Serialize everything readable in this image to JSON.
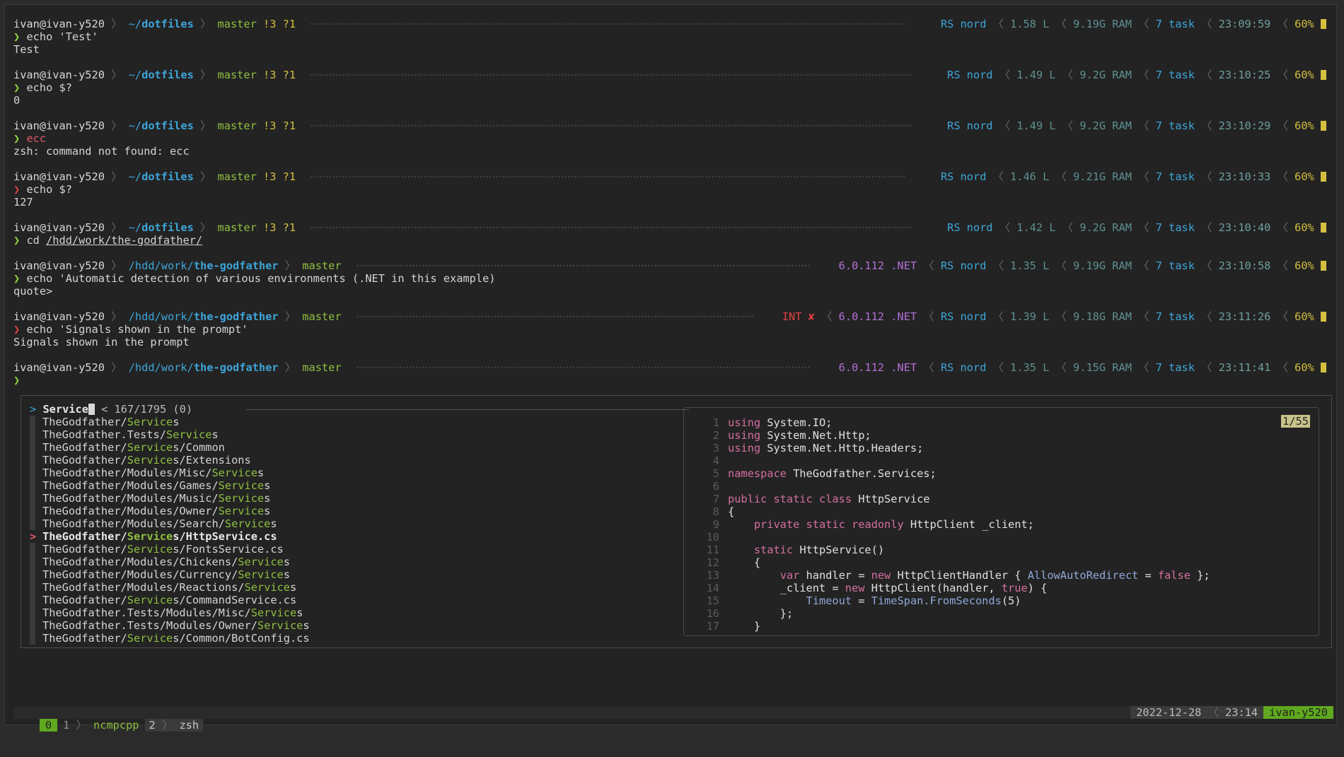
{
  "prompts": [
    {
      "host": "ivan@ivan-y520",
      "path_dim": "~/",
      "path_bold": "dotfiles",
      "git": "master",
      "gitflags": "!3 ?1",
      "int": "",
      "net": "",
      "rs": "RS nord",
      "load": "1.58 L",
      "ram": "9.19G RAM",
      "task": "7 task",
      "time": "23:09:59",
      "bat": "60%",
      "cmd": "echo 'Test'",
      "cmd_ok": true,
      "output": "Test"
    },
    {
      "host": "ivan@ivan-y520",
      "path_dim": "~/",
      "path_bold": "dotfiles",
      "git": "master",
      "gitflags": "!3 ?1",
      "int": "",
      "net": "",
      "rs": "RS nord",
      "load": "1.49 L",
      "ram": "9.2G RAM",
      "task": "7 task",
      "time": "23:10:25",
      "bat": "60%",
      "cmd": "echo $?",
      "cmd_ok": true,
      "output": "0"
    },
    {
      "host": "ivan@ivan-y520",
      "path_dim": "~/",
      "path_bold": "dotfiles",
      "git": "master",
      "gitflags": "!3 ?1",
      "int": "",
      "net": "",
      "rs": "RS nord",
      "load": "1.49 L",
      "ram": "9.2G RAM",
      "task": "7 task",
      "time": "23:10:29",
      "bat": "60%",
      "cmd": "ecc",
      "cmd_ok": true,
      "cmd_bad": true,
      "output": "zsh: command not found: ecc"
    },
    {
      "host": "ivan@ivan-y520",
      "path_dim": "~/",
      "path_bold": "dotfiles",
      "git": "master",
      "gitflags": "!3 ?1",
      "int": "",
      "net": "",
      "rs": "RS nord",
      "load": "1.46 L",
      "ram": "9.21G RAM",
      "task": "7 task",
      "time": "23:10:33",
      "bat": "60%",
      "cmd": "echo $?",
      "cmd_ok": false,
      "output": "127"
    },
    {
      "host": "ivan@ivan-y520",
      "path_dim": "~/",
      "path_bold": "dotfiles",
      "git": "master",
      "gitflags": "!3 ?1",
      "int": "",
      "net": "",
      "rs": "RS nord",
      "load": "1.42 L",
      "ram": "9.2G RAM",
      "task": "7 task",
      "time": "23:10:40",
      "bat": "60%",
      "cmd": "cd /hdd/work/the-godfather/",
      "cmd_ok": true,
      "underline_arg": "/hdd/work/the-godfather/",
      "output": ""
    },
    {
      "host": "ivan@ivan-y520",
      "path_dim": "/hdd/work/",
      "path_bold": "the-godfather",
      "git": "master",
      "gitflags": "",
      "int": "",
      "net": "6.0.112 .NET",
      "rs": "RS nord",
      "load": "1.35 L",
      "ram": "9.19G RAM",
      "task": "7 task",
      "time": "23:10:58",
      "bat": "60%",
      "cmd": "echo 'Automatic detection of various environments (.NET in this example)",
      "cmd_ok": true,
      "output": "quote>"
    },
    {
      "host": "ivan@ivan-y520",
      "path_dim": "/hdd/work/",
      "path_bold": "the-godfather",
      "git": "master",
      "gitflags": "",
      "int": "INT ✘",
      "net": "6.0.112 .NET",
      "rs": "RS nord",
      "load": "1.39 L",
      "ram": "9.18G RAM",
      "task": "7 task",
      "time": "23:11:26",
      "bat": "60%",
      "cmd": "echo 'Signals shown in the prompt'",
      "cmd_ok": false,
      "output": "Signals shown in the prompt"
    },
    {
      "host": "ivan@ivan-y520",
      "path_dim": "/hdd/work/",
      "path_bold": "the-godfather",
      "git": "master",
      "gitflags": "",
      "int": "",
      "net": "6.0.112 .NET",
      "rs": "RS nord",
      "load": "1.35 L",
      "ram": "9.15G RAM",
      "task": "7 task",
      "time": "23:11:41",
      "bat": "60%",
      "cmd": "",
      "cmd_ok": true,
      "output": ""
    }
  ],
  "symbols": {
    "arrow": "❯",
    "sep": "〉",
    "rsep": "〈",
    "fzf_prompt": ">",
    "fzf_sel": ">"
  },
  "fzf": {
    "query": "Service",
    "counter": "< 167/1795 (0)",
    "selected_index": 9,
    "items": [
      [
        "TheGodfather/",
        "Service",
        "s"
      ],
      [
        "TheGodfather.Tests/",
        "Service",
        "s"
      ],
      [
        "TheGodfather/",
        "Service",
        "s/Common"
      ],
      [
        "TheGodfather/",
        "Service",
        "s/Extensions"
      ],
      [
        "TheGodfather/Modules/Misc/",
        "Service",
        "s"
      ],
      [
        "TheGodfather/Modules/Games/",
        "Service",
        "s"
      ],
      [
        "TheGodfather/Modules/Music/",
        "Service",
        "s"
      ],
      [
        "TheGodfather/Modules/Owner/",
        "Service",
        "s"
      ],
      [
        "TheGodfather/Modules/Search/",
        "Service",
        "s"
      ],
      [
        "TheGodfather/",
        "Service",
        "s/HttpService.cs"
      ],
      [
        "TheGodfather/",
        "Service",
        "s/FontsService.cs"
      ],
      [
        "TheGodfather/Modules/Chickens/",
        "Service",
        "s"
      ],
      [
        "TheGodfather/Modules/Currency/",
        "Service",
        "s"
      ],
      [
        "TheGodfather/Modules/Reactions/",
        "Service",
        "s"
      ],
      [
        "TheGodfather/",
        "Service",
        "s/CommandService.cs"
      ],
      [
        "TheGodfather.Tests/Modules/Misc/",
        "Service",
        "s"
      ],
      [
        "TheGodfather.Tests/Modules/Owner/",
        "Service",
        "s"
      ],
      [
        "TheGodfather/",
        "Service",
        "s/Common/BotConfig.cs"
      ]
    ],
    "preview_counter": "1/55",
    "preview_lines": [
      {
        "n": "1",
        "t": [
          [
            "kw",
            "using"
          ],
          [
            "ty",
            " System.IO;"
          ]
        ]
      },
      {
        "n": "2",
        "t": [
          [
            "kw",
            "using"
          ],
          [
            "ty",
            " System.Net.Http;"
          ]
        ]
      },
      {
        "n": "3",
        "t": [
          [
            "kw",
            "using"
          ],
          [
            "ty",
            " System.Net.Http.Headers;"
          ]
        ]
      },
      {
        "n": "4",
        "t": []
      },
      {
        "n": "5",
        "t": [
          [
            "kw",
            "namespace"
          ],
          [
            "ty",
            " TheGodfather.Services;"
          ]
        ]
      },
      {
        "n": "6",
        "t": []
      },
      {
        "n": "7",
        "t": [
          [
            "kw",
            "public static class"
          ],
          [
            "ty",
            " HttpService"
          ]
        ]
      },
      {
        "n": "8",
        "t": [
          [
            "ty",
            "{"
          ]
        ]
      },
      {
        "n": "9",
        "t": [
          [
            "ty",
            "    "
          ],
          [
            "kw",
            "private static readonly"
          ],
          [
            "ty",
            " HttpClient _client;"
          ]
        ]
      },
      {
        "n": "10",
        "t": []
      },
      {
        "n": "11",
        "t": [
          [
            "ty",
            "    "
          ],
          [
            "kw",
            "static"
          ],
          [
            "ty",
            " HttpService()"
          ]
        ]
      },
      {
        "n": "12",
        "t": [
          [
            "ty",
            "    {"
          ]
        ]
      },
      {
        "n": "13",
        "t": [
          [
            "ty",
            "        "
          ],
          [
            "kw",
            "var"
          ],
          [
            "ty",
            " handler = "
          ],
          [
            "kw",
            "new"
          ],
          [
            "ty",
            " HttpClientHandler { "
          ],
          [
            "kb",
            "AllowAutoRedirect"
          ],
          [
            "ty",
            " = "
          ],
          [
            "kw",
            "false"
          ],
          [
            "ty",
            " };"
          ]
        ]
      },
      {
        "n": "14",
        "t": [
          [
            "ty",
            "        _client = "
          ],
          [
            "kw",
            "new"
          ],
          [
            "ty",
            " HttpClient(handler, "
          ],
          [
            "kw",
            "true"
          ],
          [
            "ty",
            ") {"
          ]
        ]
      },
      {
        "n": "15",
        "t": [
          [
            "ty",
            "            "
          ],
          [
            "kb",
            "Timeout"
          ],
          [
            "ty",
            " = "
          ],
          [
            "kb",
            "TimeSpan.FromSeconds"
          ],
          [
            "ty",
            "(5)"
          ]
        ]
      },
      {
        "n": "16",
        "t": [
          [
            "ty",
            "        };"
          ]
        ]
      },
      {
        "n": "17",
        "t": [
          [
            "ty",
            "    }"
          ]
        ]
      }
    ]
  },
  "tmux": {
    "session": "0",
    "windows": [
      {
        "index": "1",
        "name": "ncmpcpp"
      },
      {
        "index": "2",
        "name": "zsh"
      }
    ],
    "date": "2022-12-28",
    "time": "23:14",
    "host": "ivan-y520"
  },
  "colors": {
    "accent_blue": "#3da5d9",
    "git_green": "#8fbf3f",
    "net_purple": "#b36fd6",
    "error_red": "#e04040",
    "battery_yellow": "#d4bf3f",
    "tmux_green": "#5fa81f"
  }
}
